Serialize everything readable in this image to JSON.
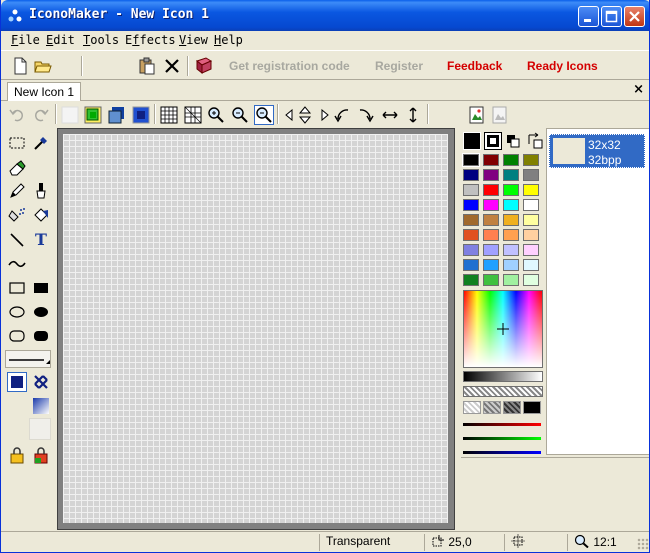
{
  "window": {
    "title": "IconoMaker - New Icon 1"
  },
  "menu": [
    {
      "label": "File",
      "mnemonic": "F",
      "rest": "ile"
    },
    {
      "label": "Edit",
      "mnemonic": "E",
      "rest": "dit"
    },
    {
      "label": "Tools",
      "mnemonic": "T",
      "rest": "ools"
    },
    {
      "label": "Effects",
      "mnemonic": "f",
      "pre": "E",
      "rest": "fects"
    },
    {
      "label": "View",
      "mnemonic": "V",
      "rest": "iew"
    },
    {
      "label": "Help",
      "mnemonic": "H",
      "rest": "elp"
    }
  ],
  "toolbar": {
    "get_code": "Get registration code",
    "register": "Register",
    "feedback": "Feedback",
    "ready_icons": "Ready Icons"
  },
  "tabs": [
    {
      "label": "New Icon 1"
    }
  ],
  "tab_close": "×",
  "sizes": [
    {
      "size": "32x32",
      "depth": "32bpp"
    }
  ],
  "status": {
    "color": "Transparent",
    "coords": "25,0",
    "zoom": "12:1"
  },
  "palette": [
    "#000000",
    "#800000",
    "#008000",
    "#808000",
    "#000080",
    "#800080",
    "#008080",
    "#808080",
    "#c0c0c0",
    "#ff0000",
    "#00ff00",
    "#ffff00",
    "#0000ff",
    "#ff00ff",
    "#00ffff",
    "#ffffff",
    "#a0692c",
    "#c08040",
    "#f0b020",
    "#ffffa0",
    "#e05020",
    "#ff8050",
    "#ffa050",
    "#ffd0a0",
    "#8080e0",
    "#a0a0ff",
    "#c0c0ff",
    "#ffd0ff",
    "#2070d0",
    "#20a0ff",
    "#a0d0ff",
    "#e0f8ff",
    "#108020",
    "#40c040",
    "#a0f0a0",
    "#e0ffe0"
  ]
}
